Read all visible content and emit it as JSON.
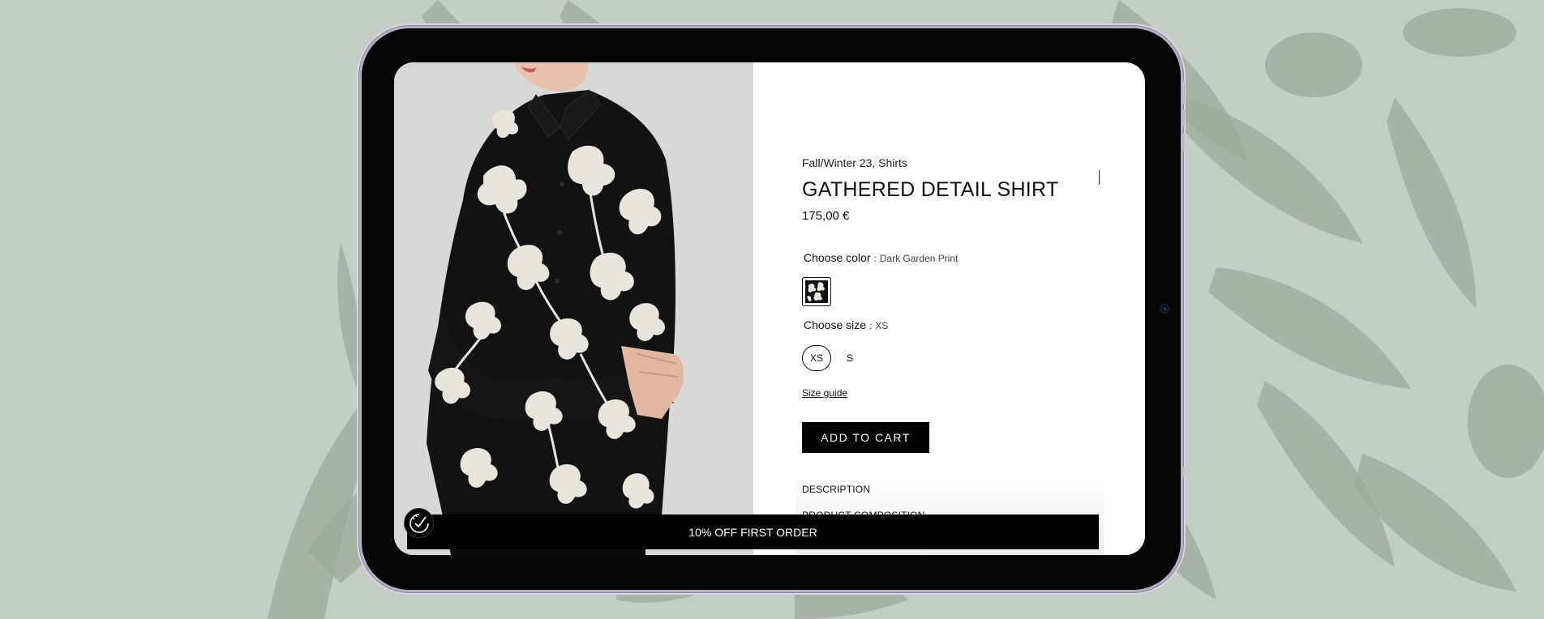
{
  "product": {
    "breadcrumb": "Fall/Winter 23, Shirts",
    "title": "GATHERED DETAIL SHIRT",
    "price": "175,00 €"
  },
  "color": {
    "label": "Choose color",
    "separator": ":",
    "selected": "Dark Garden Print",
    "swatch_icon": "floral-print-swatch"
  },
  "size": {
    "label": "Choose size",
    "separator": ":",
    "selected": "XS",
    "options": [
      "XS",
      "S"
    ]
  },
  "links": {
    "size_guide": "Size guide"
  },
  "actions": {
    "add_to_cart": "ADD TO CART"
  },
  "accordion": {
    "items": [
      "DESCRIPTION",
      "PRODUCT COMPOSITION"
    ]
  },
  "promo": {
    "text": "10% OFF FIRST ORDER",
    "badge_icon": "discount-badge-icon"
  },
  "colors": {
    "background": "#c5cec4",
    "accent": "#000000",
    "device_frame": "#b2adbf"
  }
}
